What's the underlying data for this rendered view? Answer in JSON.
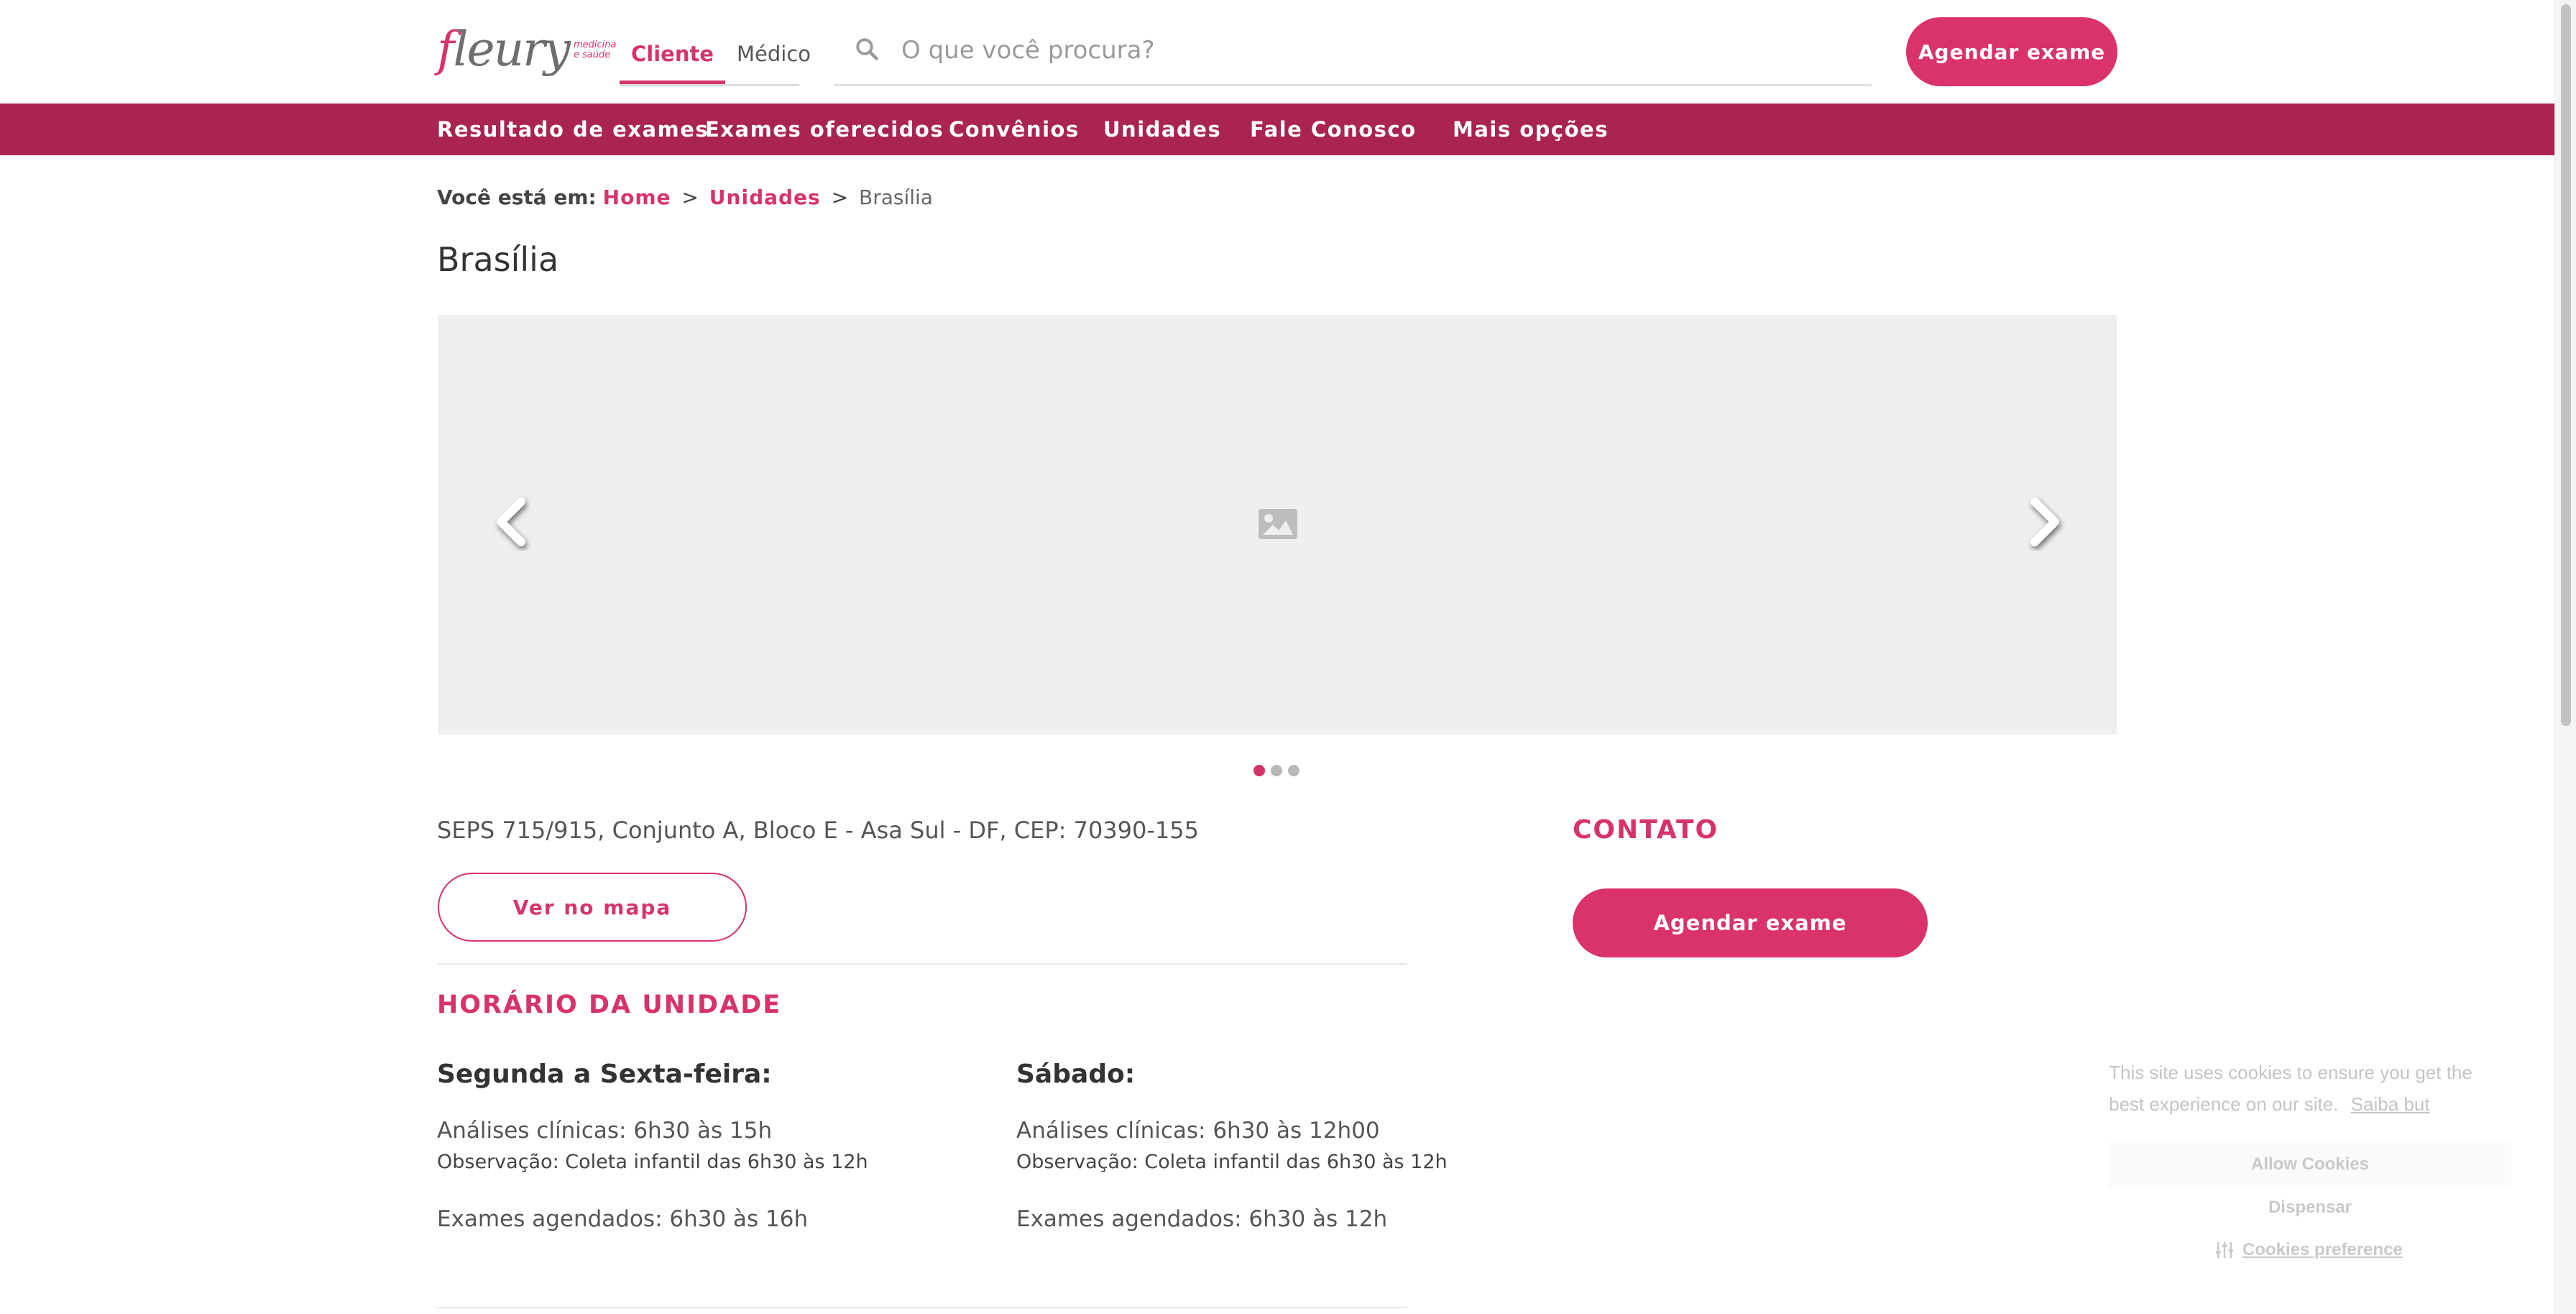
{
  "colors": {
    "brand": "#d6336c",
    "nav_bg": "#a9244e",
    "carousel_bg": "#efefef"
  },
  "header": {
    "logo": {
      "text_main": "fleury",
      "text_sub_1": "medicina",
      "text_sub_2": "e saúde"
    },
    "tabs": [
      {
        "label": "Cliente",
        "active": true
      },
      {
        "label": "Médico",
        "active": false
      }
    ],
    "search": {
      "placeholder": "O que você procura?",
      "value": "",
      "icon": "search-icon"
    },
    "cta_label": "Agendar exame"
  },
  "nav": {
    "items": [
      {
        "label": "Resultado de exames"
      },
      {
        "label": "Exames oferecidos"
      },
      {
        "label": "Convênios"
      },
      {
        "label": "Unidades"
      },
      {
        "label": "Fale Conosco"
      },
      {
        "label": "Mais opções"
      }
    ]
  },
  "breadcrumb": {
    "prefix": "Você está em:",
    "items": [
      {
        "label": "Home"
      },
      {
        "label": "Unidades"
      }
    ],
    "separator": ">",
    "current": "Brasília"
  },
  "page": {
    "title": "Brasília"
  },
  "carousel": {
    "slide_count": 3,
    "active_index": 0,
    "icons": [
      "chevron-left-icon",
      "image-placeholder-icon",
      "chevron-right-icon"
    ]
  },
  "unit": {
    "address": "SEPS 715/915, Conjunto A, Bloco E - Asa Sul - DF, CEP: 70390-155",
    "map_button": "Ver no mapa",
    "hours_title": "HORÁRIO DA UNIDADE",
    "hours": [
      {
        "day": "Segunda a Sexta-feira:",
        "clinical": "Análises clínicas: 6h30 às 15h",
        "note": "Observação: Coleta infantil das 6h30 às 12h",
        "scheduled": "Exames agendados: 6h30 às 16h"
      },
      {
        "day": "Sábado:",
        "clinical": "Análises clínicas: 6h30 às 12h00",
        "note": "Observação: Coleta infantil das 6h30 às 12h",
        "scheduled": "Exames agendados: 6h30 às 12h"
      }
    ]
  },
  "contact": {
    "title": "CONTATO",
    "cta_label": "Agendar exame"
  },
  "cookie": {
    "text": "This site uses cookies to ensure you get the best experience on our site.",
    "link": "Saiba but",
    "allow": "Allow Cookies",
    "dismiss": "Dispensar",
    "preference": "Cookies preference"
  }
}
